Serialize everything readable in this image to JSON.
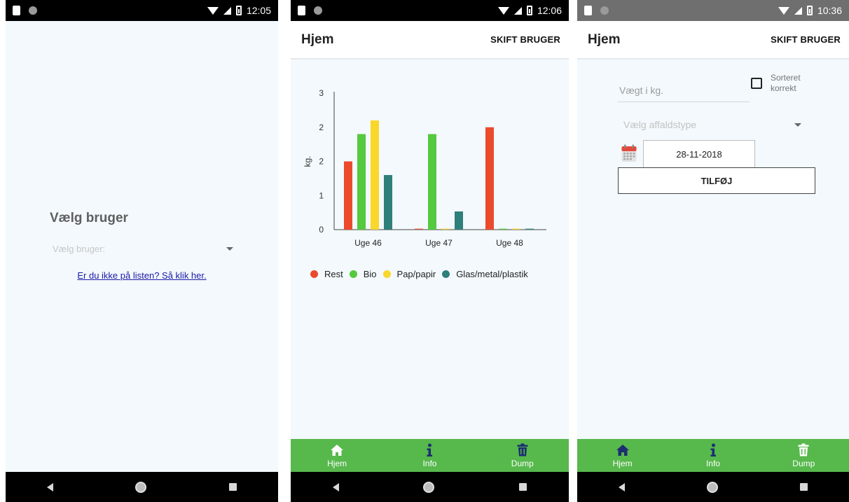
{
  "screens": {
    "select_user": {
      "status_time": "12:05",
      "heading": "Vælg bruger",
      "select_placeholder": "Vælg bruger:",
      "not_listed_link": "Er du ikke på listen? Så klik her."
    },
    "home_chart": {
      "status_time": "12:06",
      "title": "Hjem",
      "switch_user": "SKIFT BRUGER"
    },
    "add_waste": {
      "status_time": "10:36",
      "title": "Hjem",
      "switch_user": "SKIFT BRUGER",
      "weight_placeholder": "Vægt i kg.",
      "sorted_label": "Sorteret korrekt",
      "sorted_checked": false,
      "type_placeholder": "Vælg affaldstype",
      "date_value": "28-11-2018",
      "add_button": "TILFØJ"
    }
  },
  "tabs": [
    {
      "label": "Hjem",
      "icon": "home-icon"
    },
    {
      "label": "Info",
      "icon": "info-icon"
    },
    {
      "label": "Dump",
      "icon": "trash-icon"
    }
  ],
  "colors": {
    "tabbar": "#57b84c",
    "rest": "#eb4a2c",
    "bio": "#55c93f",
    "pap": "#f9d72b",
    "glas": "#2f7f7a"
  },
  "chart_data": {
    "type": "bar",
    "categories": [
      "Uge 46",
      "Uge 47",
      "Uge 48"
    ],
    "series": [
      {
        "name": "Rest",
        "color": "#eb4a2c",
        "values": [
          1.5,
          0,
          2.25
        ]
      },
      {
        "name": "Bio",
        "color": "#55c93f",
        "values": [
          2.1,
          2.1,
          0
        ]
      },
      {
        "name": "Pap/papir",
        "color": "#f9d72b",
        "values": [
          2.4,
          0,
          0
        ]
      },
      {
        "name": "Glas/metal/plastik",
        "color": "#2f7f7a",
        "values": [
          1.2,
          0.4,
          0
        ]
      }
    ],
    "ylabel": "kg.",
    "y_tick_labels": [
      "0",
      "1",
      "2",
      "2",
      "3"
    ],
    "ylim": [
      0,
      3
    ],
    "grid": false,
    "legend_position": "bottom"
  }
}
